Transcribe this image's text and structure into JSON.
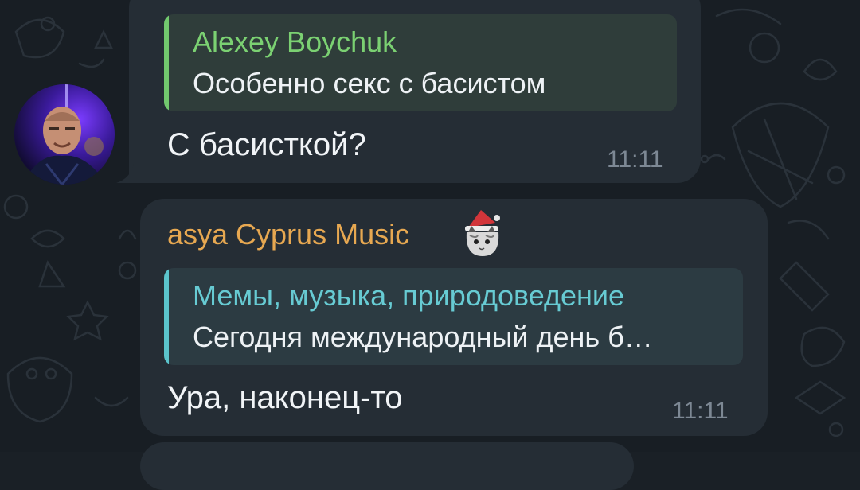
{
  "messages": [
    {
      "reply": {
        "author": "Alexey Boychuk",
        "text": "Особенно секс с басистом"
      },
      "text": "С басисткой?",
      "time": "11:11"
    },
    {
      "sender": "asya Cyprus Music",
      "reply": {
        "author": "Мемы, музыка, природоведение",
        "text": "Сегодня международный день б…"
      },
      "text": "Ура, наконец-то",
      "time": "11:11"
    }
  ],
  "colors": {
    "background": "#181e24",
    "bubble": "#252d35",
    "reply_green": "#72c86e",
    "reply_teal": "#5bc4cc",
    "sender_orange": "#e7a851",
    "time": "#7d8894"
  },
  "icons": {
    "sender_status": "cat-with-santa-hat-emoji",
    "avatar": "user-avatar-photo"
  }
}
